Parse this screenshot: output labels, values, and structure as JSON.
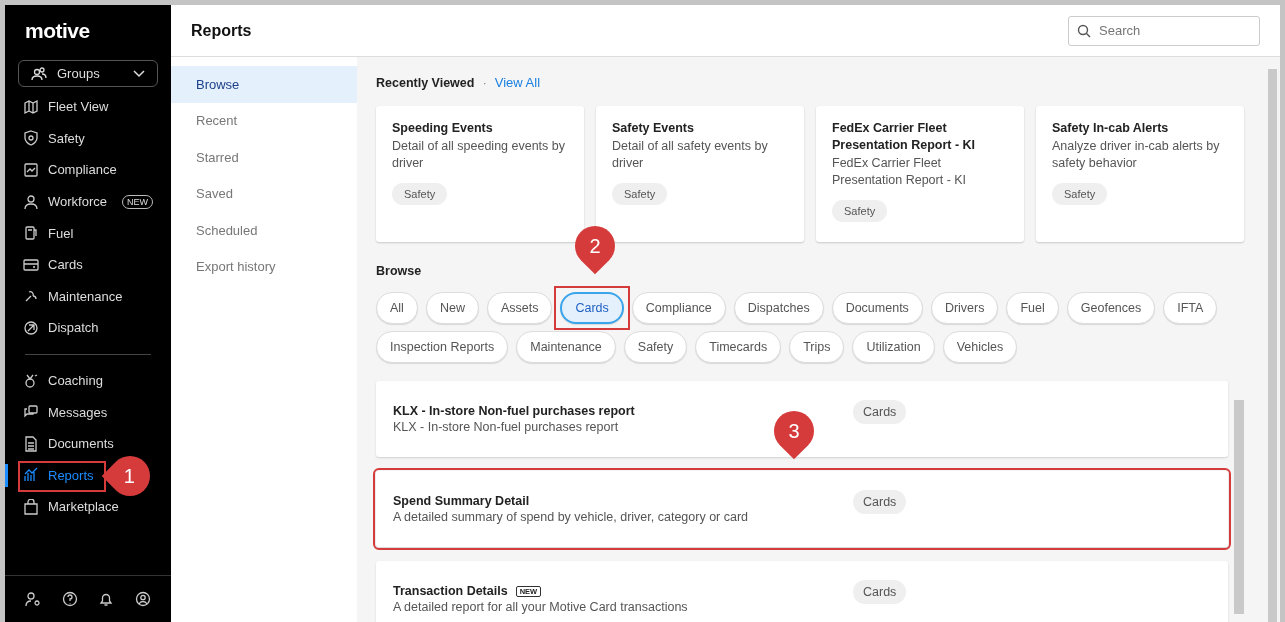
{
  "sidebar": {
    "logo": "motive",
    "groups_dropdown": {
      "label": "Groups"
    },
    "primary_items": [
      {
        "label": "Fleet View",
        "selected": false
      },
      {
        "label": "Safety",
        "selected": false
      },
      {
        "label": "Compliance",
        "selected": false
      },
      {
        "label": "Workforce",
        "selected": false,
        "badge": "NEW"
      },
      {
        "label": "Fuel",
        "selected": false
      },
      {
        "label": "Cards",
        "selected": false
      },
      {
        "label": "Maintenance",
        "selected": false
      },
      {
        "label": "Dispatch",
        "selected": false
      }
    ],
    "secondary_items": [
      {
        "label": "Coaching",
        "selected": false
      },
      {
        "label": "Messages",
        "selected": false
      },
      {
        "label": "Documents",
        "selected": false
      },
      {
        "label": "Reports",
        "selected": true,
        "callout": "1"
      },
      {
        "label": "Marketplace",
        "selected": false
      }
    ]
  },
  "header": {
    "title": "Reports",
    "search": {
      "placeholder": "Search"
    }
  },
  "subnav": [
    {
      "label": "Browse",
      "selected": true
    },
    {
      "label": "Recent",
      "selected": false
    },
    {
      "label": "Starred",
      "selected": false
    },
    {
      "label": "Saved",
      "selected": false
    },
    {
      "label": "Scheduled",
      "selected": false
    },
    {
      "label": "Export history",
      "selected": false
    }
  ],
  "recently_viewed": {
    "title": "Recently Viewed",
    "separator": "·",
    "link": "View All",
    "cards": [
      {
        "title": "Speeding Events",
        "description": "Detail of all speeding events by driver",
        "tag": "Safety"
      },
      {
        "title": "Safety Events",
        "description": "Detail of all safety events by driver",
        "tag": "Safety"
      },
      {
        "title": "FedEx Carrier Fleet Presentation Report - KI",
        "description": "FedEx Carrier Fleet Presentation Report - KI",
        "tag": "Safety"
      },
      {
        "title": "Safety In-cab Alerts",
        "description": "Analyze driver in-cab alerts by safety behavior",
        "tag": "Safety"
      }
    ]
  },
  "browse": {
    "title": "Browse",
    "filters": [
      {
        "label": "All",
        "selected": false
      },
      {
        "label": "New",
        "selected": false
      },
      {
        "label": "Assets",
        "selected": false
      },
      {
        "label": "Cards",
        "selected": true,
        "callout": "2"
      },
      {
        "label": "Compliance",
        "selected": false
      },
      {
        "label": "Dispatches",
        "selected": false
      },
      {
        "label": "Documents",
        "selected": false
      },
      {
        "label": "Drivers",
        "selected": false
      },
      {
        "label": "Fuel",
        "selected": false
      },
      {
        "label": "Geofences",
        "selected": false
      },
      {
        "label": "IFTA",
        "selected": false
      },
      {
        "label": "Inspection Reports",
        "selected": false
      },
      {
        "label": "Maintenance",
        "selected": false
      },
      {
        "label": "Safety",
        "selected": false
      },
      {
        "label": "Timecards",
        "selected": false
      },
      {
        "label": "Trips",
        "selected": false
      },
      {
        "label": "Utilization",
        "selected": false
      },
      {
        "label": "Vehicles",
        "selected": false
      }
    ],
    "reports": [
      {
        "title": "KLX - In-store Non-fuel purchases report",
        "description": "KLX - In-store Non-fuel purchases report",
        "tag": "Cards"
      },
      {
        "title": "Spend Summary Detail",
        "description": "A detailed summary of spend by vehicle, driver, category or card",
        "tag": "Cards",
        "callout": "3"
      },
      {
        "title": "Transaction Details",
        "badge": "NEW",
        "description": "A detailed report for all your Motive Card transactions",
        "tag": "Cards"
      }
    ]
  }
}
